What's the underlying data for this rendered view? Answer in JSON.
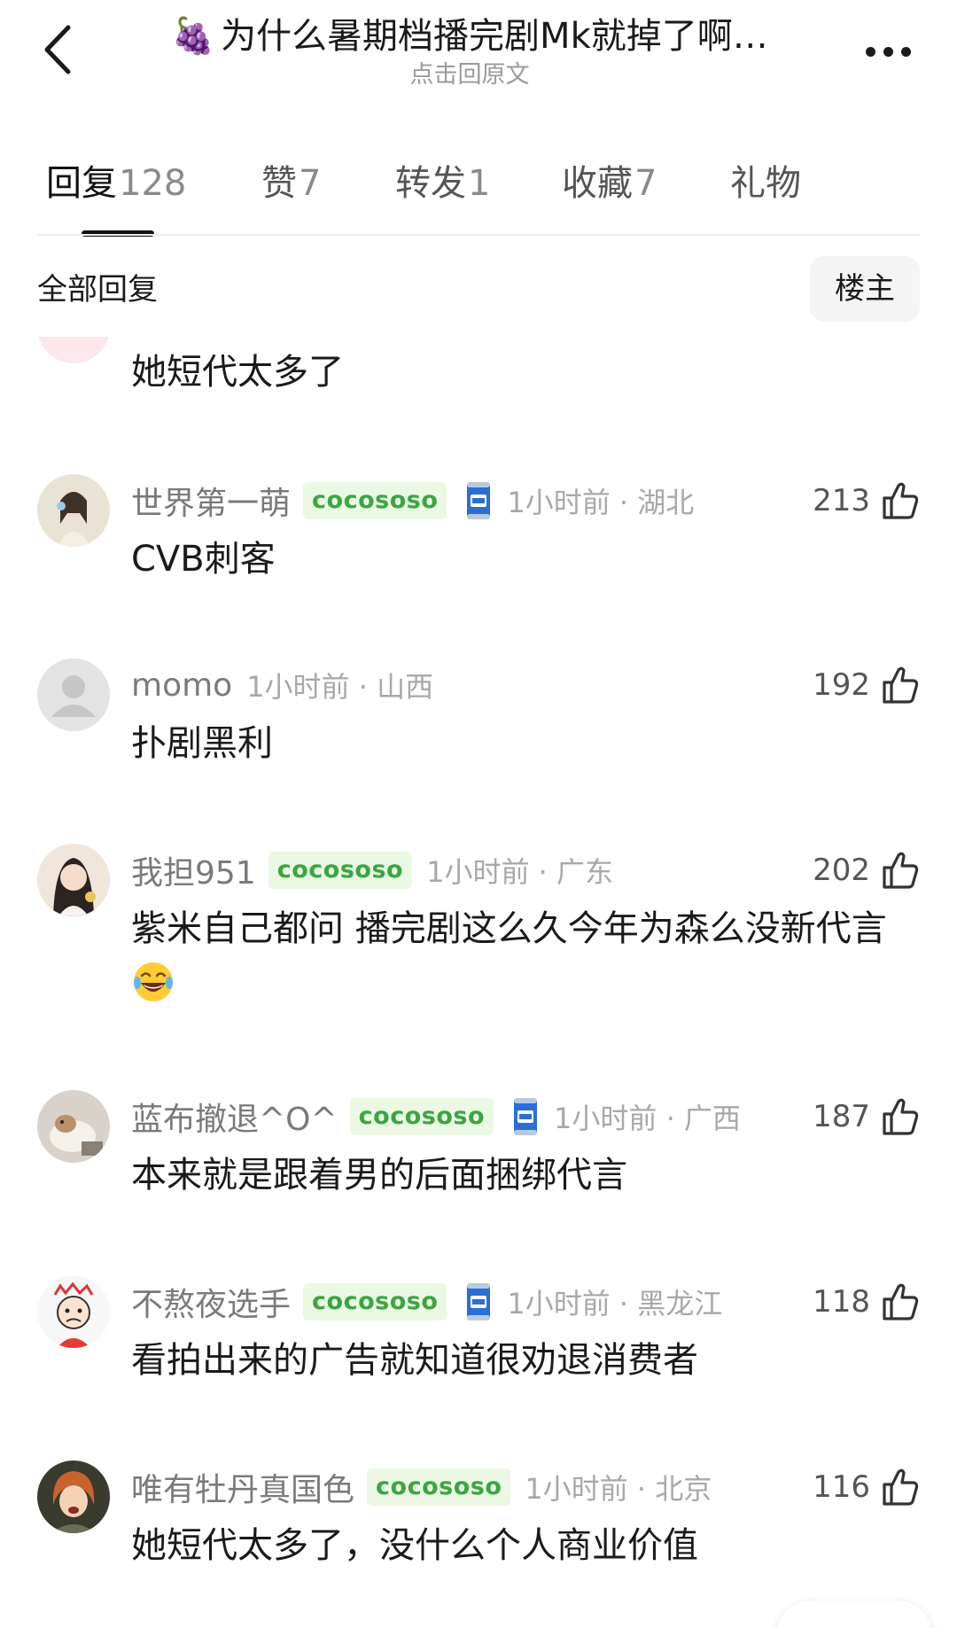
{
  "header": {
    "title_emoji": "🍇",
    "title": "为什么暑期档播完剧Mk就掉了啊…",
    "subtitle": "点击回原文",
    "back_icon": "chevron-left-icon",
    "more_icon": "more-dots-icon"
  },
  "tabs": [
    {
      "label": "回复",
      "count": "128",
      "active": true
    },
    {
      "label": "赞",
      "count": "7",
      "active": false
    },
    {
      "label": "转发",
      "count": "1",
      "active": false
    },
    {
      "label": "收藏",
      "count": "7",
      "active": false
    },
    {
      "label": "礼物",
      "count": "",
      "active": false
    }
  ],
  "filter": {
    "all_replies": "全部回复",
    "op_only": "楼主"
  },
  "partial_comment": {
    "text": "她短代太多了"
  },
  "comments": [
    {
      "username": "世界第一萌",
      "badge": "cocososo",
      "has_can_icon": true,
      "time_location": "1小时前 · 湖北",
      "likes": "213",
      "text": "CVB刺客"
    },
    {
      "username": "momo",
      "badge": "",
      "has_can_icon": false,
      "time_location": "1小时前 · 山西",
      "likes": "192",
      "text": "扑剧黑利"
    },
    {
      "username": "我担951",
      "badge": "cocososo",
      "has_can_icon": false,
      "time_location": "1小时前 · 广东",
      "likes": "202",
      "text": "紫米自己都问 播完剧这么久今年为森么没新代言",
      "emoji": "😂"
    },
    {
      "username": "蓝布撤退^O^",
      "badge": "cocososo",
      "has_can_icon": true,
      "time_location": "1小时前 · 广西",
      "likes": "187",
      "text": "本来就是跟着男的后面捆绑代言"
    },
    {
      "username": "不熬夜选手",
      "badge": "cocososo",
      "has_can_icon": true,
      "time_location": "1小时前 · 黑龙江",
      "likes": "118",
      "text": "看拍出来的广告就知道很劝退消费者"
    },
    {
      "username": "唯有牡丹真国色",
      "badge": "cocososo",
      "has_can_icon": false,
      "time_location": "1小时前 · 北京",
      "likes": "116",
      "text": "她短代太多了，没什么个人商业价值"
    }
  ],
  "colors": {
    "badge_text": "#3ba641",
    "badge_bg": "#eaf8e4",
    "meta_gray": "#a8a8a8",
    "text_dark": "#1a1a1a"
  }
}
